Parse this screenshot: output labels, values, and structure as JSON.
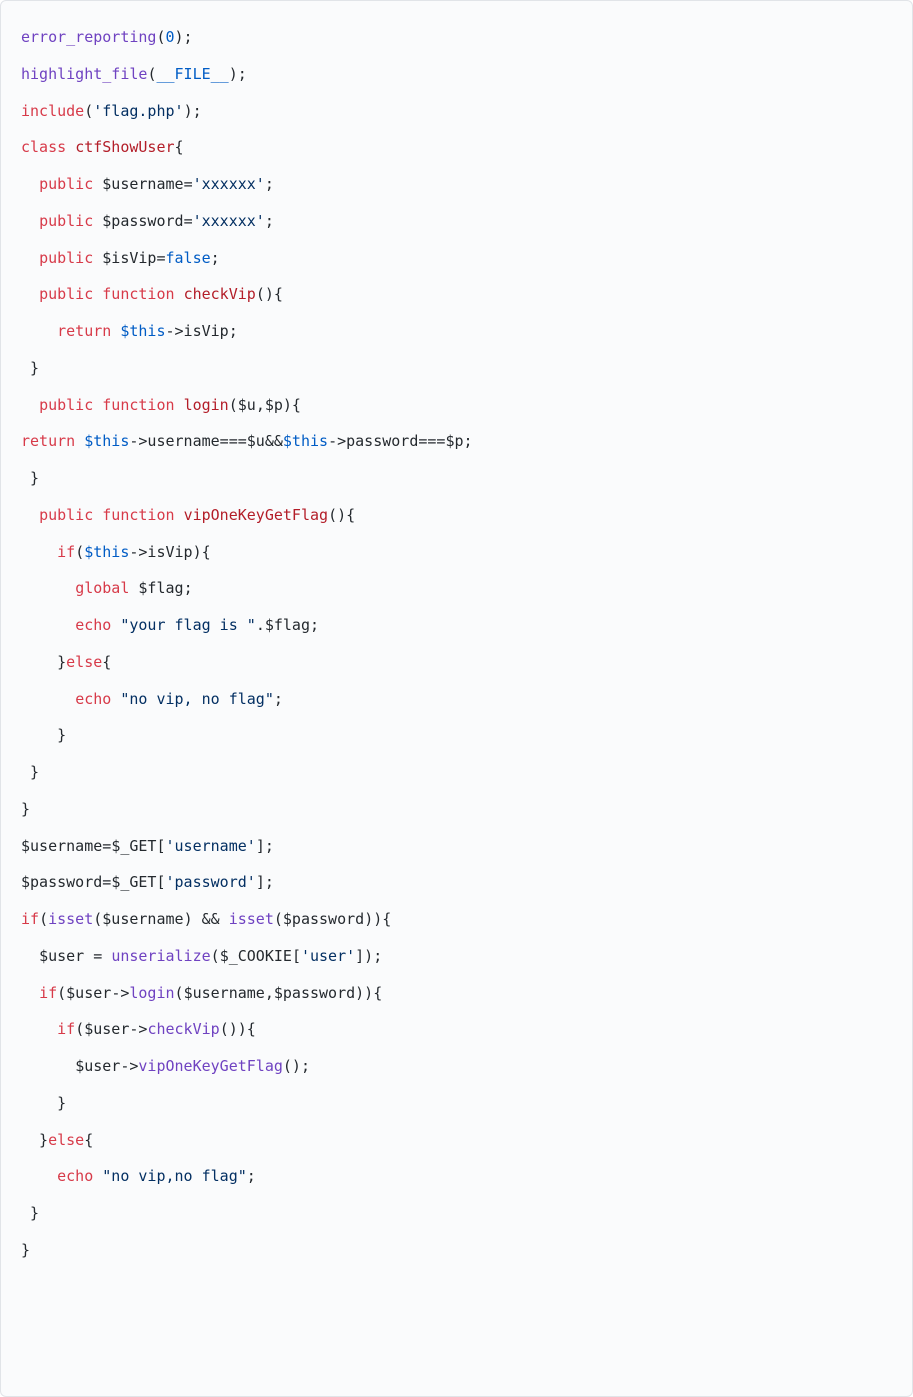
{
  "code": {
    "lines": [
      [
        {
          "cls": "t-func",
          "key": "l1.a"
        },
        {
          "cls": "t-plain",
          "key": "l1.b"
        },
        {
          "cls": "t-num",
          "key": "l1.c"
        },
        {
          "cls": "t-plain",
          "key": "l1.d"
        }
      ],
      [
        {
          "cls": "t-func",
          "key": "l2.a"
        },
        {
          "cls": "t-plain",
          "key": "l2.b"
        },
        {
          "cls": "t-const",
          "key": "l2.c"
        },
        {
          "cls": "t-plain",
          "key": "l2.d"
        }
      ],
      [
        {
          "cls": "t-kw",
          "key": "l3.a"
        },
        {
          "cls": "t-plain",
          "key": "l3.b"
        },
        {
          "cls": "t-str",
          "key": "l3.c"
        },
        {
          "cls": "t-plain",
          "key": "l3.d"
        }
      ],
      [
        {
          "cls": "t-kw",
          "key": "l4.a"
        },
        {
          "cls": "t-plain",
          "key": "l4.b"
        },
        {
          "cls": "t-cls",
          "key": "l4.c"
        },
        {
          "cls": "t-plain",
          "key": "l4.d"
        }
      ],
      [
        {
          "cls": "t-plain",
          "key": "l5.a"
        },
        {
          "cls": "t-kw",
          "key": "l5.b"
        },
        {
          "cls": "t-plain",
          "key": "l5.c"
        },
        {
          "cls": "t-var",
          "key": "l5.d"
        },
        {
          "cls": "t-plain",
          "key": "l5.e"
        },
        {
          "cls": "t-str",
          "key": "l5.f"
        },
        {
          "cls": "t-plain",
          "key": "l5.g"
        }
      ],
      [
        {
          "cls": "t-plain",
          "key": "l6.a"
        },
        {
          "cls": "t-kw",
          "key": "l6.b"
        },
        {
          "cls": "t-plain",
          "key": "l6.c"
        },
        {
          "cls": "t-var",
          "key": "l6.d"
        },
        {
          "cls": "t-plain",
          "key": "l6.e"
        },
        {
          "cls": "t-str",
          "key": "l6.f"
        },
        {
          "cls": "t-plain",
          "key": "l6.g"
        }
      ],
      [
        {
          "cls": "t-plain",
          "key": "l7.a"
        },
        {
          "cls": "t-kw",
          "key": "l7.b"
        },
        {
          "cls": "t-plain",
          "key": "l7.c"
        },
        {
          "cls": "t-var",
          "key": "l7.d"
        },
        {
          "cls": "t-plain",
          "key": "l7.e"
        },
        {
          "cls": "t-bool",
          "key": "l7.f"
        },
        {
          "cls": "t-plain",
          "key": "l7.g"
        }
      ],
      [
        {
          "cls": "t-plain",
          "key": "l8.a"
        },
        {
          "cls": "t-kw",
          "key": "l8.b"
        },
        {
          "cls": "t-plain",
          "key": "l8.c"
        },
        {
          "cls": "t-kw",
          "key": "l8.d"
        },
        {
          "cls": "t-plain",
          "key": "l8.e"
        },
        {
          "cls": "t-fn",
          "key": "l8.f"
        },
        {
          "cls": "t-plain",
          "key": "l8.g"
        }
      ],
      [
        {
          "cls": "t-plain",
          "key": "l9.a"
        },
        {
          "cls": "t-kw",
          "key": "l9.b"
        },
        {
          "cls": "t-plain",
          "key": "l9.c"
        },
        {
          "cls": "t-this",
          "key": "l9.d"
        },
        {
          "cls": "t-plain",
          "key": "l9.e"
        }
      ],
      [
        {
          "cls": "t-plain",
          "key": "l10.a"
        }
      ],
      [
        {
          "cls": "t-plain",
          "key": "l11.a"
        },
        {
          "cls": "t-kw",
          "key": "l11.b"
        },
        {
          "cls": "t-plain",
          "key": "l11.c"
        },
        {
          "cls": "t-kw",
          "key": "l11.d"
        },
        {
          "cls": "t-plain",
          "key": "l11.e"
        },
        {
          "cls": "t-fn",
          "key": "l11.f"
        },
        {
          "cls": "t-plain",
          "key": "l11.g"
        },
        {
          "cls": "t-var",
          "key": "l11.h"
        },
        {
          "cls": "t-plain",
          "key": "l11.i"
        },
        {
          "cls": "t-var",
          "key": "l11.j"
        },
        {
          "cls": "t-plain",
          "key": "l11.k"
        }
      ],
      [
        {
          "cls": "t-kw",
          "key": "l12.a"
        },
        {
          "cls": "t-plain",
          "key": "l12.b"
        },
        {
          "cls": "t-this",
          "key": "l12.c"
        },
        {
          "cls": "t-plain",
          "key": "l12.d"
        },
        {
          "cls": "t-var",
          "key": "l12.e"
        },
        {
          "cls": "t-plain",
          "key": "l12.f"
        },
        {
          "cls": "t-this",
          "key": "l12.g"
        },
        {
          "cls": "t-plain",
          "key": "l12.h"
        },
        {
          "cls": "t-var",
          "key": "l12.i"
        },
        {
          "cls": "t-plain",
          "key": "l12.j"
        }
      ],
      [
        {
          "cls": "t-plain",
          "key": "l13.a"
        }
      ],
      [
        {
          "cls": "t-plain",
          "key": "l14.a"
        },
        {
          "cls": "t-kw",
          "key": "l14.b"
        },
        {
          "cls": "t-plain",
          "key": "l14.c"
        },
        {
          "cls": "t-kw",
          "key": "l14.d"
        },
        {
          "cls": "t-plain",
          "key": "l14.e"
        },
        {
          "cls": "t-fn",
          "key": "l14.f"
        },
        {
          "cls": "t-plain",
          "key": "l14.g"
        }
      ],
      [
        {
          "cls": "t-plain",
          "key": "l15.a"
        },
        {
          "cls": "t-kw",
          "key": "l15.b"
        },
        {
          "cls": "t-plain",
          "key": "l15.c"
        },
        {
          "cls": "t-this",
          "key": "l15.d"
        },
        {
          "cls": "t-plain",
          "key": "l15.e"
        }
      ],
      [
        {
          "cls": "t-plain",
          "key": "l16.a"
        },
        {
          "cls": "t-kw",
          "key": "l16.b"
        },
        {
          "cls": "t-plain",
          "key": "l16.c"
        },
        {
          "cls": "t-var",
          "key": "l16.d"
        },
        {
          "cls": "t-plain",
          "key": "l16.e"
        }
      ],
      [
        {
          "cls": "t-plain",
          "key": "l17.a"
        },
        {
          "cls": "t-kw",
          "key": "l17.b"
        },
        {
          "cls": "t-plain",
          "key": "l17.c"
        },
        {
          "cls": "t-str",
          "key": "l17.d"
        },
        {
          "cls": "t-plain",
          "key": "l17.e"
        },
        {
          "cls": "t-var",
          "key": "l17.f"
        },
        {
          "cls": "t-plain",
          "key": "l17.g"
        }
      ],
      [
        {
          "cls": "t-plain",
          "key": "l18.a"
        },
        {
          "cls": "t-kw",
          "key": "l18.b"
        },
        {
          "cls": "t-plain",
          "key": "l18.c"
        }
      ],
      [
        {
          "cls": "t-plain",
          "key": "l19.a"
        },
        {
          "cls": "t-kw",
          "key": "l19.b"
        },
        {
          "cls": "t-plain",
          "key": "l19.c"
        },
        {
          "cls": "t-str",
          "key": "l19.d"
        },
        {
          "cls": "t-plain",
          "key": "l19.e"
        }
      ],
      [
        {
          "cls": "t-plain",
          "key": "l20.a"
        }
      ],
      [
        {
          "cls": "t-plain",
          "key": "l21.a"
        }
      ],
      [
        {
          "cls": "t-plain",
          "key": "l22.a"
        }
      ],
      [
        {
          "cls": "t-var",
          "key": "l23.a"
        },
        {
          "cls": "t-plain",
          "key": "l23.b"
        },
        {
          "cls": "t-var",
          "key": "l23.c"
        },
        {
          "cls": "t-plain",
          "key": "l23.d"
        },
        {
          "cls": "t-str",
          "key": "l23.e"
        },
        {
          "cls": "t-plain",
          "key": "l23.f"
        }
      ],
      [
        {
          "cls": "t-var",
          "key": "l24.a"
        },
        {
          "cls": "t-plain",
          "key": "l24.b"
        },
        {
          "cls": "t-var",
          "key": "l24.c"
        },
        {
          "cls": "t-plain",
          "key": "l24.d"
        },
        {
          "cls": "t-str",
          "key": "l24.e"
        },
        {
          "cls": "t-plain",
          "key": "l24.f"
        }
      ],
      [
        {
          "cls": "t-kw",
          "key": "l25.a"
        },
        {
          "cls": "t-plain",
          "key": "l25.b"
        },
        {
          "cls": "t-func",
          "key": "l25.c"
        },
        {
          "cls": "t-plain",
          "key": "l25.d"
        },
        {
          "cls": "t-var",
          "key": "l25.e"
        },
        {
          "cls": "t-plain",
          "key": "l25.f"
        },
        {
          "cls": "t-func",
          "key": "l25.g"
        },
        {
          "cls": "t-plain",
          "key": "l25.h"
        },
        {
          "cls": "t-var",
          "key": "l25.i"
        },
        {
          "cls": "t-plain",
          "key": "l25.j"
        }
      ],
      [
        {
          "cls": "t-plain",
          "key": "l26.a"
        },
        {
          "cls": "t-var",
          "key": "l26.b"
        },
        {
          "cls": "t-plain",
          "key": "l26.c"
        },
        {
          "cls": "t-func",
          "key": "l26.d"
        },
        {
          "cls": "t-plain",
          "key": "l26.e"
        },
        {
          "cls": "t-var",
          "key": "l26.f"
        },
        {
          "cls": "t-plain",
          "key": "l26.g"
        },
        {
          "cls": "t-str",
          "key": "l26.h"
        },
        {
          "cls": "t-plain",
          "key": "l26.i"
        }
      ],
      [
        {
          "cls": "t-plain",
          "key": "l27.a"
        },
        {
          "cls": "t-kw",
          "key": "l27.b"
        },
        {
          "cls": "t-plain",
          "key": "l27.c"
        },
        {
          "cls": "t-var",
          "key": "l27.d"
        },
        {
          "cls": "t-plain",
          "key": "l27.e"
        },
        {
          "cls": "t-func",
          "key": "l27.f"
        },
        {
          "cls": "t-plain",
          "key": "l27.g"
        },
        {
          "cls": "t-var",
          "key": "l27.h"
        },
        {
          "cls": "t-plain",
          "key": "l27.i"
        },
        {
          "cls": "t-var",
          "key": "l27.j"
        },
        {
          "cls": "t-plain",
          "key": "l27.k"
        }
      ],
      [
        {
          "cls": "t-plain",
          "key": "l28.a"
        },
        {
          "cls": "t-kw",
          "key": "l28.b"
        },
        {
          "cls": "t-plain",
          "key": "l28.c"
        },
        {
          "cls": "t-var",
          "key": "l28.d"
        },
        {
          "cls": "t-plain",
          "key": "l28.e"
        },
        {
          "cls": "t-func",
          "key": "l28.f"
        },
        {
          "cls": "t-plain",
          "key": "l28.g"
        }
      ],
      [
        {
          "cls": "t-plain",
          "key": "l29.a"
        },
        {
          "cls": "t-var",
          "key": "l29.b"
        },
        {
          "cls": "t-plain",
          "key": "l29.c"
        },
        {
          "cls": "t-func",
          "key": "l29.d"
        },
        {
          "cls": "t-plain",
          "key": "l29.e"
        }
      ],
      [
        {
          "cls": "t-plain",
          "key": "l30.a"
        }
      ],
      [
        {
          "cls": "t-plain",
          "key": "l31.a"
        },
        {
          "cls": "t-kw",
          "key": "l31.b"
        },
        {
          "cls": "t-plain",
          "key": "l31.c"
        }
      ],
      [
        {
          "cls": "t-plain",
          "key": "l32.a"
        },
        {
          "cls": "t-kw",
          "key": "l32.b"
        },
        {
          "cls": "t-plain",
          "key": "l32.c"
        },
        {
          "cls": "t-str",
          "key": "l32.d"
        },
        {
          "cls": "t-plain",
          "key": "l32.e"
        }
      ],
      [
        {
          "cls": "t-plain",
          "key": "l33.a"
        }
      ],
      [
        {
          "cls": "t-plain",
          "key": "l34.a"
        }
      ]
    ]
  },
  "tokens": {
    "l1": {
      "a": "error_reporting",
      "b": "(",
      "c": "0",
      "d": ");"
    },
    "l2": {
      "a": "highlight_file",
      "b": "(",
      "c": "__FILE__",
      "d": ");"
    },
    "l3": {
      "a": "include",
      "b": "(",
      "c": "'flag.php'",
      "d": ");"
    },
    "l4": {
      "a": "class",
      "b": " ",
      "c": "ctfShowUser",
      "d": "{"
    },
    "l5": {
      "a": "  ",
      "b": "public",
      "c": " ",
      "d": "$username",
      "e": "=",
      "f": "'xxxxxx'",
      "g": ";"
    },
    "l6": {
      "a": "  ",
      "b": "public",
      "c": " ",
      "d": "$password",
      "e": "=",
      "f": "'xxxxxx'",
      "g": ";"
    },
    "l7": {
      "a": "  ",
      "b": "public",
      "c": " ",
      "d": "$isVip",
      "e": "=",
      "f": "false",
      "g": ";"
    },
    "l8": {
      "a": "  ",
      "b": "public",
      "c": " ",
      "d": "function",
      "e": " ",
      "f": "checkVip",
      "g": "(){"
    },
    "l9": {
      "a": "    ",
      "b": "return",
      "c": " ",
      "d": "$this",
      "e": "->isVip;"
    },
    "l10": {
      "a": " }"
    },
    "l11": {
      "a": "  ",
      "b": "public",
      "c": " ",
      "d": "function",
      "e": " ",
      "f": "login",
      "g": "(",
      "h": "$u",
      "i": ",",
      "j": "$p",
      "k": "){"
    },
    "l12": {
      "a": "return",
      "b": " ",
      "c": "$this",
      "d": "->username===",
      "e": "$u",
      "f": "&&",
      "g": "$this",
      "h": "->password===",
      "i": "$p",
      "j": ";"
    },
    "l13": {
      "a": " }"
    },
    "l14": {
      "a": "  ",
      "b": "public",
      "c": " ",
      "d": "function",
      "e": " ",
      "f": "vipOneKeyGetFlag",
      "g": "(){"
    },
    "l15": {
      "a": "    ",
      "b": "if",
      "c": "(",
      "d": "$this",
      "e": "->isVip){"
    },
    "l16": {
      "a": "      ",
      "b": "global",
      "c": " ",
      "d": "$flag",
      "e": ";"
    },
    "l17": {
      "a": "      ",
      "b": "echo",
      "c": " ",
      "d": "\"your flag is \"",
      "e": ".",
      "f": "$flag",
      "g": ";"
    },
    "l18": {
      "a": "    }",
      "b": "else",
      "c": "{"
    },
    "l19": {
      "a": "      ",
      "b": "echo",
      "c": " ",
      "d": "\"no vip, no flag\"",
      "e": ";"
    },
    "l20": {
      "a": "    }"
    },
    "l21": {
      "a": " }"
    },
    "l22": {
      "a": "}"
    },
    "l23": {
      "a": "$username",
      "b": "=",
      "c": "$_GET",
      "d": "[",
      "e": "'username'",
      "f": "];"
    },
    "l24": {
      "a": "$password",
      "b": "=",
      "c": "$_GET",
      "d": "[",
      "e": "'password'",
      "f": "];"
    },
    "l25": {
      "a": "if",
      "b": "(",
      "c": "isset",
      "d": "(",
      "e": "$username",
      "f": ") && ",
      "g": "isset",
      "h": "(",
      "i": "$password",
      "j": ")){"
    },
    "l26": {
      "a": "  ",
      "b": "$user",
      "c": " = ",
      "d": "unserialize",
      "e": "(",
      "f": "$_COOKIE",
      "g": "[",
      "h": "'user'",
      "i": "]);"
    },
    "l27": {
      "a": "  ",
      "b": "if",
      "c": "(",
      "d": "$user",
      "e": "->",
      "f": "login",
      "g": "(",
      "h": "$username",
      "i": ",",
      "j": "$password",
      "k": ")){"
    },
    "l28": {
      "a": "    ",
      "b": "if",
      "c": "(",
      "d": "$user",
      "e": "->",
      "f": "checkVip",
      "g": "()){"
    },
    "l29": {
      "a": "      ",
      "b": "$user",
      "c": "->",
      "d": "vipOneKeyGetFlag",
      "e": "();"
    },
    "l30": {
      "a": "    }"
    },
    "l31": {
      "a": "  }",
      "b": "else",
      "c": "{"
    },
    "l32": {
      "a": "    ",
      "b": "echo",
      "c": " ",
      "d": "\"no vip,no flag\"",
      "e": ";"
    },
    "l33": {
      "a": " }"
    },
    "l34": {
      "a": "}"
    }
  }
}
